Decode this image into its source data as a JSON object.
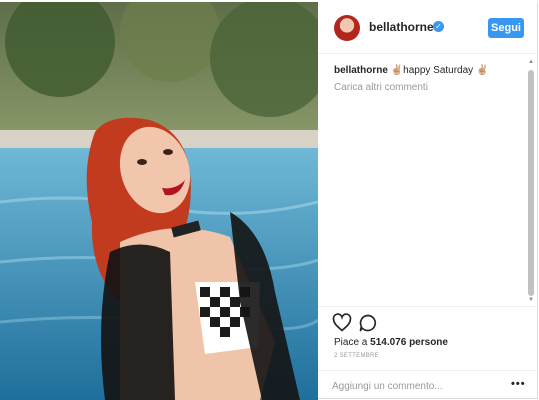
{
  "post": {
    "username": "bellathorne",
    "verified_icon": "verified-badge-icon",
    "follow_label": "Segui",
    "caption_user": "bellathorne",
    "caption_text": " ✌🏼happy Saturday ✌🏼",
    "load_more_label": "Carica altri commenti",
    "likes_prefix": "Piace a ",
    "likes_count": "514.076",
    "likes_suffix": " persone",
    "date": "2 SETTEMBRE",
    "comment_placeholder": "Aggiungi un commento...",
    "more_options": "•••"
  },
  "colors": {
    "accent": "#3897f0",
    "text": "#262626",
    "muted": "#999999",
    "border": "#efefef"
  },
  "icons": [
    "heart-icon",
    "comment-icon",
    "verified-badge-icon",
    "more-options-icon",
    "scroll-up-icon",
    "scroll-down-icon"
  ]
}
